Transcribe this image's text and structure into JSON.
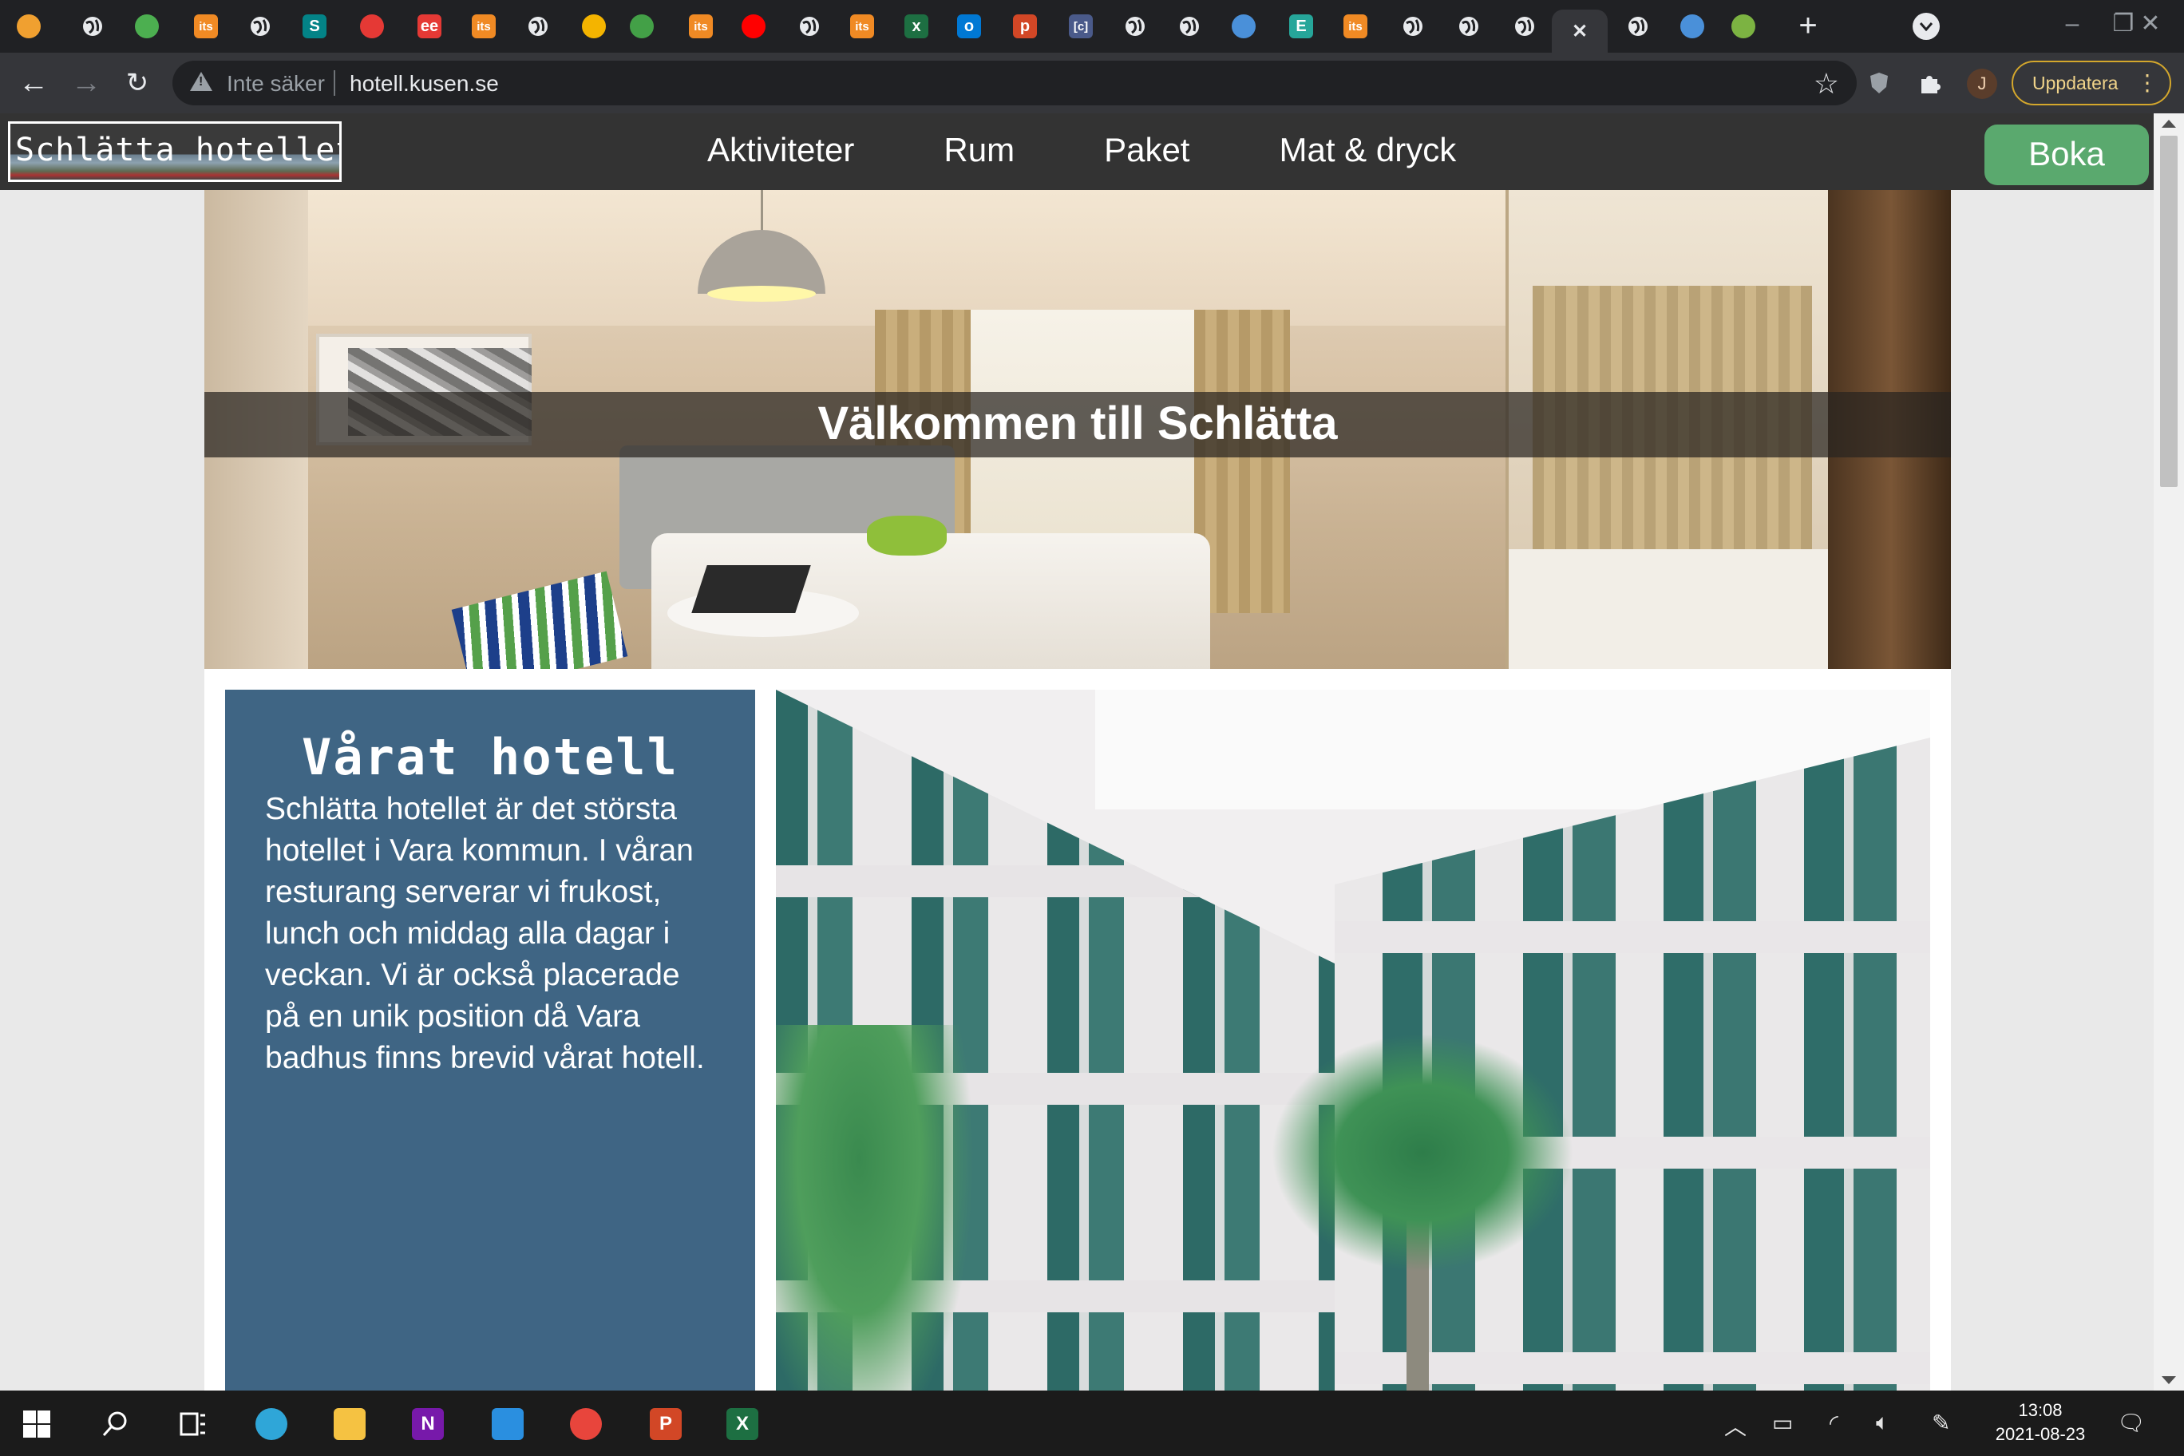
{
  "browser": {
    "tabs": [
      {
        "icon": "brave-lion-icon",
        "color": "#f0a030"
      },
      {
        "icon": "globe-icon",
        "color": "#e8eaed"
      },
      {
        "icon": "pinwheel-icon",
        "color": "#4caf50"
      },
      {
        "icon": "its-icon",
        "label": "its",
        "color": "#f08a24"
      },
      {
        "icon": "globe-icon",
        "color": "#e8eaed"
      },
      {
        "icon": "sharepoint-icon",
        "label": "S",
        "color": "#038387"
      },
      {
        "icon": "redbadge-icon",
        "color": "#e53935"
      },
      {
        "icon": "ee-icon",
        "label": "ee",
        "color": "#e53935"
      },
      {
        "icon": "its-icon",
        "label": "its",
        "color": "#f08a24"
      },
      {
        "icon": "globe-icon",
        "color": "#e8eaed"
      },
      {
        "icon": "dots-icon",
        "color": "#f4b400"
      },
      {
        "icon": "image-icon",
        "color": "#43a047"
      },
      {
        "icon": "its-icon",
        "label": "its",
        "color": "#f08a24"
      },
      {
        "icon": "youtube-icon",
        "color": "#ff0000"
      },
      {
        "icon": "globe-icon",
        "color": "#e8eaed"
      },
      {
        "icon": "its-icon",
        "label": "its",
        "color": "#f08a24"
      },
      {
        "icon": "excel-icon",
        "label": "x",
        "color": "#1d6f42"
      },
      {
        "icon": "outlook-icon",
        "label": "o",
        "color": "#0078d4"
      },
      {
        "icon": "powerpoint-icon",
        "label": "p",
        "color": "#d24726"
      },
      {
        "icon": "code-bracket-icon",
        "label": "[c]",
        "color": "#4a5a8a"
      },
      {
        "icon": "globe-icon",
        "color": "#e8eaed"
      },
      {
        "icon": "globe-icon",
        "color": "#e8eaed"
      },
      {
        "icon": "calendar-icon",
        "color": "#4a90d9"
      },
      {
        "icon": "e-icon",
        "label": "E",
        "color": "#26a69a"
      },
      {
        "icon": "its-icon",
        "label": "its",
        "color": "#f08a24"
      },
      {
        "icon": "globe-icon",
        "color": "#e8eaed"
      },
      {
        "icon": "globe-icon",
        "color": "#e8eaed"
      },
      {
        "icon": "globe-icon",
        "color": "#e8eaed"
      },
      {
        "icon": "close-icon",
        "color": "#e8eaed",
        "active": true
      },
      {
        "icon": "globe-icon",
        "color": "#e8eaed"
      },
      {
        "icon": "check-icon",
        "color": "#4a90d9"
      },
      {
        "icon": "feather-icon",
        "color": "#7cb342"
      }
    ],
    "address": {
      "security_label": "Inte säker",
      "url": "hotell.kusen.se"
    },
    "profile_initial": "J",
    "update_label": "Uppdatera"
  },
  "site": {
    "logo_text": "Schlätta hotellet",
    "nav": [
      "Aktiviteter",
      "Rum",
      "Paket",
      "Mat & dryck"
    ],
    "book_label": "Boka",
    "hero_title": "Välkommen till Schlätta",
    "about": {
      "heading": "Vårat hotell",
      "body": "Schlätta hotellet är det största hotellet i Vara kommun. I våran resturang serverar vi frukost, lunch och middag alla dagar i veckan. Vi är också placerade på en unik position då Vara badhus finns brevid vårat hotell."
    },
    "colors": {
      "nav_bg": "#333333",
      "book_button": "#5aa96e",
      "about_card": "#3f6584"
    }
  },
  "taskbar": {
    "apps": [
      {
        "icon": "windows-start-icon"
      },
      {
        "icon": "search-icon"
      },
      {
        "icon": "task-view-icon"
      },
      {
        "icon": "edge-icon",
        "color": "#2fa6d8"
      },
      {
        "icon": "file-explorer-icon",
        "color": "#f5c242"
      },
      {
        "icon": "onenote-icon",
        "label": "N",
        "color": "#7719aa"
      },
      {
        "icon": "vscode-icon",
        "color": "#2a8fe0"
      },
      {
        "icon": "chrome-icon",
        "color": "#e8453c"
      },
      {
        "icon": "powerpoint-icon",
        "label": "P",
        "color": "#d24726"
      },
      {
        "icon": "excel-icon",
        "label": "X",
        "color": "#1d6f42"
      }
    ],
    "time": "13:08",
    "date": "2021-08-23"
  }
}
